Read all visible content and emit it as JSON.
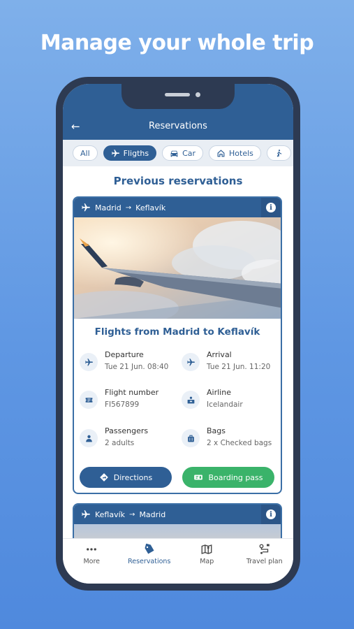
{
  "headline": "Manage your whole trip",
  "app": {
    "title": "Reservations",
    "back_icon": "back-arrow-icon"
  },
  "filters": [
    {
      "label": "All",
      "icon": "",
      "active": false
    },
    {
      "label": "Fligths",
      "icon": "plane-icon",
      "active": true
    },
    {
      "label": "Car",
      "icon": "car-icon",
      "active": false
    },
    {
      "label": "Hotels",
      "icon": "home-icon",
      "active": false
    },
    {
      "label": "",
      "icon": "walking-person-icon",
      "active": false
    }
  ],
  "section_title": "Previous reservations",
  "reservation": {
    "origin": "Madrid",
    "destination": "Keflavík",
    "route_arrow": "→",
    "info_label": "i",
    "title": "Flights from Madrid to Keflavík",
    "details": {
      "departure": {
        "label": "Departure",
        "value": "Tue 21 Jun. 08:40"
      },
      "arrival": {
        "label": "Arrival",
        "value": "Tue 21 Jun. 11:20"
      },
      "flight_number": {
        "label": "Flight number",
        "value": "FI567899"
      },
      "airline": {
        "label": "Airline",
        "value": "Icelandair"
      },
      "passengers": {
        "label": "Passengers",
        "value": "2 adults"
      },
      "bags": {
        "label": "Bags",
        "value": "2 x Checked bags"
      }
    },
    "directions_label": "Directions",
    "boarding_pass_label": "Boarding pass"
  },
  "reservation2": {
    "origin": "Keflavík",
    "destination": "Madrid",
    "route_arrow": "→",
    "info_label": "i"
  },
  "tabbar": {
    "more": "More",
    "reservations": "Reservations",
    "map": "Map",
    "travel_plan": "Travel plan"
  },
  "colors": {
    "primary": "#2f5f95",
    "success": "#3ab36a",
    "background": "#6a9fe6"
  }
}
